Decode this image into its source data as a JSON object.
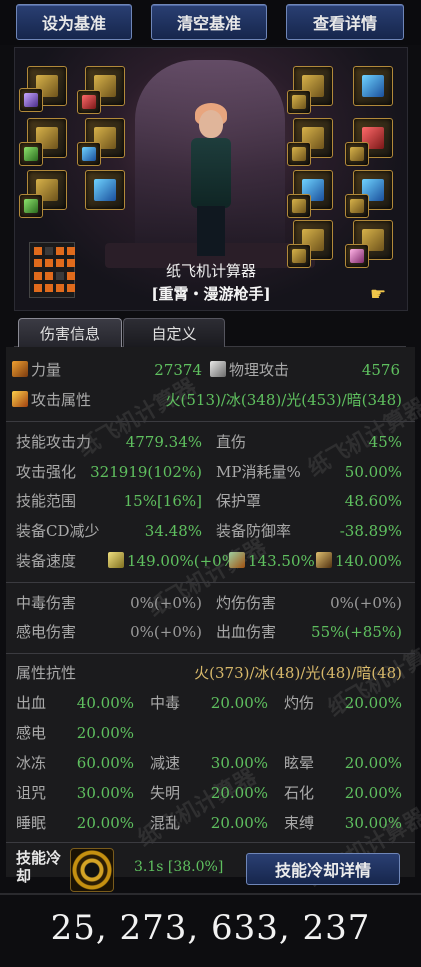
{
  "toolbar": {
    "set_base": "设为基准",
    "clear_base": "清空基准",
    "view_details": "查看详情"
  },
  "character": {
    "name": "纸飞机计算器",
    "class": "[重霄・漫游枪手]"
  },
  "tabs": [
    "伤害信息",
    "自定义"
  ],
  "stats": {
    "strength_label": "力量",
    "strength": "27374",
    "phys_atk_label": "物理攻击",
    "phys_atk": "4576",
    "elem_label": "攻击属性",
    "elem_value": "火(513)/冰(348)/光(453)/暗(348)"
  },
  "skill": {
    "skill_atk_label": "技能攻击力",
    "skill_atk": "4779.34%",
    "direct_label": "直伤",
    "direct": "45%",
    "enhance_label": "攻击强化",
    "enhance": "321919(102%)",
    "mp_label": "MP消耗量%",
    "mp": "50.00%",
    "range_label": "技能范围",
    "range": "15%[16%]",
    "shield_label": "保护罩",
    "shield": "48.60%",
    "cd_reduce_label": "装备CD减少",
    "cd_reduce": "34.48%",
    "def_label": "装备防御率",
    "def": "-38.89%",
    "speed_label": "装备速度",
    "speed1": "149.00%(+0%)",
    "speed2": "143.50%",
    "speed3": "140.00%"
  },
  "status_dmg": {
    "poison_label": "中毒伤害",
    "poison": "0%(+0%)",
    "burn_label": "灼伤伤害",
    "burn": "0%(+0%)",
    "shock_label": "感电伤害",
    "shock": "0%(+0%)",
    "bleed_label": "出血伤害",
    "bleed": "55%(+85%)"
  },
  "resist": {
    "title": "属性抗性",
    "value": "火(373)/冰(48)/光(48)/暗(48)",
    "rows": [
      [
        [
          "出血",
          "40.00%"
        ],
        [
          "中毒",
          "20.00%"
        ],
        [
          "灼伤",
          "20.00%"
        ]
      ],
      [
        [
          "感电",
          "20.00%"
        ],
        [
          "",
          ""
        ],
        [
          "",
          ""
        ]
      ],
      [
        [
          "冰冻",
          "60.00%"
        ],
        [
          "减速",
          "30.00%"
        ],
        [
          "眩晕",
          "20.00%"
        ]
      ],
      [
        [
          "诅咒",
          "30.00%"
        ],
        [
          "失明",
          "20.00%"
        ],
        [
          "石化",
          "20.00%"
        ]
      ],
      [
        [
          "睡眠",
          "20.00%"
        ],
        [
          "混乱",
          "20.00%"
        ],
        [
          "束缚",
          "30.00%"
        ]
      ]
    ]
  },
  "cooldown": {
    "label": "技能冷却",
    "value": "3.1s [38.0%]",
    "button": "技能冷却详情"
  },
  "total": "25, 273, 633, 237",
  "watermark": "纸飞机计算器"
}
